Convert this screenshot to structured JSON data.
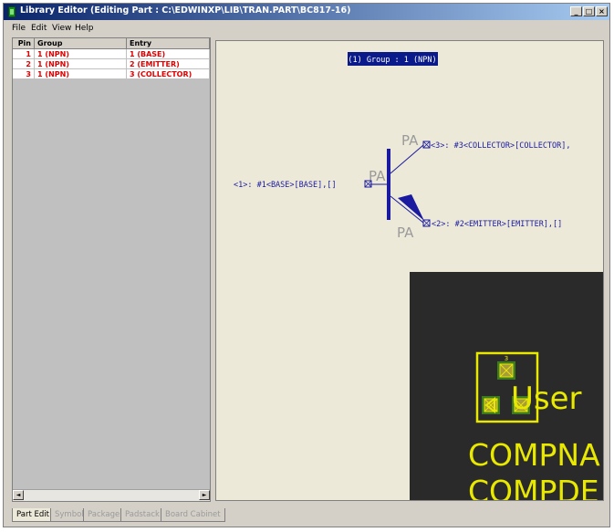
{
  "window": {
    "title": "Library Editor (Editing Part : C:\\EDWINXP\\LIB\\TRAN.PART\\BC817-16)",
    "controls": {
      "minimize": "_",
      "maximize": "□",
      "close": "×"
    }
  },
  "menu": [
    "File",
    "Edit",
    "View",
    "Help"
  ],
  "table": {
    "headers": [
      "Pin",
      "Group",
      "Entry"
    ],
    "rows": [
      {
        "pin": "1",
        "group": "1 (NPN)",
        "entry": "1 (BASE)"
      },
      {
        "pin": "2",
        "group": "1 (NPN)",
        "entry": "2 (EMITTER)"
      },
      {
        "pin": "3",
        "group": "1 (NPN)",
        "entry": "3 (COLLECTOR)"
      }
    ],
    "scroll_left": "◄",
    "scroll_right": "►"
  },
  "schematic": {
    "group_label": "(1) Group : 1 (NPN)",
    "pin1_label": "<1>: #1<BASE>[BASE],[]",
    "pin2_label": "<2>: #2<EMITTER>[EMITTER],[]",
    "pin3_label": "<3>: #3<COLLECTOR>[COLLECTOR],",
    "pa_label": "PA",
    "colors": {
      "schematic": "#1a1aa0",
      "pa": "#9a9a9a",
      "pcb_bg": "#2a2a2a",
      "pcb_fg": "#e8e800",
      "pad": "#3c7a20"
    }
  },
  "pcb": {
    "user_text": "User",
    "compname_text": "COMPNA",
    "compdesc_text": "COMPDE",
    "pin_num": "3"
  },
  "tabs": [
    "Part Edit",
    "Symbol",
    "Package",
    "Padstack",
    "Board Cabinet"
  ]
}
